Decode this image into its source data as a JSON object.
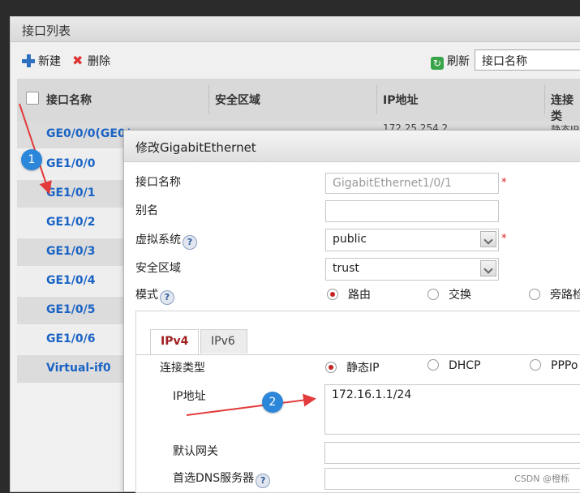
{
  "panel": {
    "title": "接口列表"
  },
  "toolbar": {
    "new_label": "新建",
    "delete_label": "删除",
    "refresh_label": "刷新",
    "search_value": "接口名称"
  },
  "table": {
    "columns": [
      "接口名称",
      "安全区域",
      "IP地址",
      "连接类"
    ],
    "rows": [
      "GE0/0/0(GE0/",
      "GE1/0/0",
      "GE1/0/1",
      "GE1/0/2",
      "GE1/0/3",
      "GE1/0/4",
      "GE1/0/5",
      "GE1/0/6",
      "Virtual-if0"
    ],
    "partial_ip": "172.25.254.2",
    "partial_type": "静态IP"
  },
  "dialog": {
    "title": "修改GigabitEthernet",
    "fields": {
      "interface_name_label": "接口名称",
      "interface_name_value": "GigabitEthernet1/0/1",
      "alias_label": "别名",
      "alias_value": "",
      "vsys_label": "虚拟系统",
      "vsys_value": "public",
      "zone_label": "安全区域",
      "zone_value": "trust",
      "mode_label": "模式",
      "mode_options": [
        "路由",
        "交换",
        "旁路检"
      ],
      "required_mark": "*"
    },
    "tabs": [
      "IPv4",
      "IPv6"
    ],
    "ipv4": {
      "conn_type_label": "连接类型",
      "conn_options": [
        "静态IP",
        "DHCP",
        "PPPo"
      ],
      "ip_label": "IP地址",
      "ip_value": "172.16.1.1/24",
      "gateway_label": "默认网关",
      "gateway_value": "",
      "dns_label": "首选DNS服务器",
      "dns_value": ""
    },
    "help_glyph": "?"
  },
  "annotations": {
    "badge1": "1",
    "badge2": "2",
    "arrow_color": "#e23b3b"
  },
  "watermark": "CSDN @橙栎",
  "colors": {
    "link": "#1a63c5",
    "badge": "#2c86d9",
    "required": "#e02020"
  }
}
